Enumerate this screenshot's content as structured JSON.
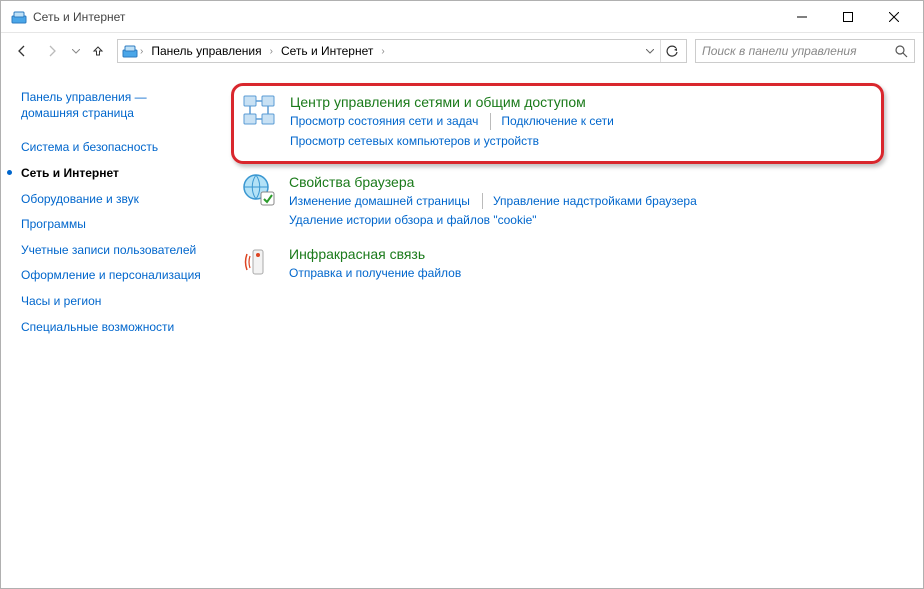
{
  "window": {
    "title": "Сеть и Интернет"
  },
  "breadcrumb": {
    "root": "Панель управления",
    "current": "Сеть и Интернет"
  },
  "search": {
    "placeholder": "Поиск в панели управления"
  },
  "sidebar": {
    "home_line1": "Панель управления —",
    "home_line2": "домашняя страница",
    "items": [
      {
        "label": "Система и безопасность",
        "active": false
      },
      {
        "label": "Сеть и Интернет",
        "active": true
      },
      {
        "label": "Оборудование и звук",
        "active": false
      },
      {
        "label": "Программы",
        "active": false
      },
      {
        "label": "Учетные записи пользователей",
        "active": false
      },
      {
        "label": "Оформление и персонализация",
        "active": false
      },
      {
        "label": "Часы и регион",
        "active": false
      },
      {
        "label": "Специальные возможности",
        "active": false
      }
    ]
  },
  "main": {
    "sections": [
      {
        "title": "Центр управления сетями и общим доступом",
        "links": [
          "Просмотр состояния сети и задач",
          "Подключение к сети",
          "Просмотр сетевых компьютеров и устройств"
        ]
      },
      {
        "title": "Свойства браузера",
        "links": [
          "Изменение домашней страницы",
          "Управление надстройками браузера",
          "Удаление истории обзора и файлов \"cookie\""
        ]
      },
      {
        "title": "Инфракрасная связь",
        "links": [
          "Отправка и получение файлов"
        ]
      }
    ]
  }
}
